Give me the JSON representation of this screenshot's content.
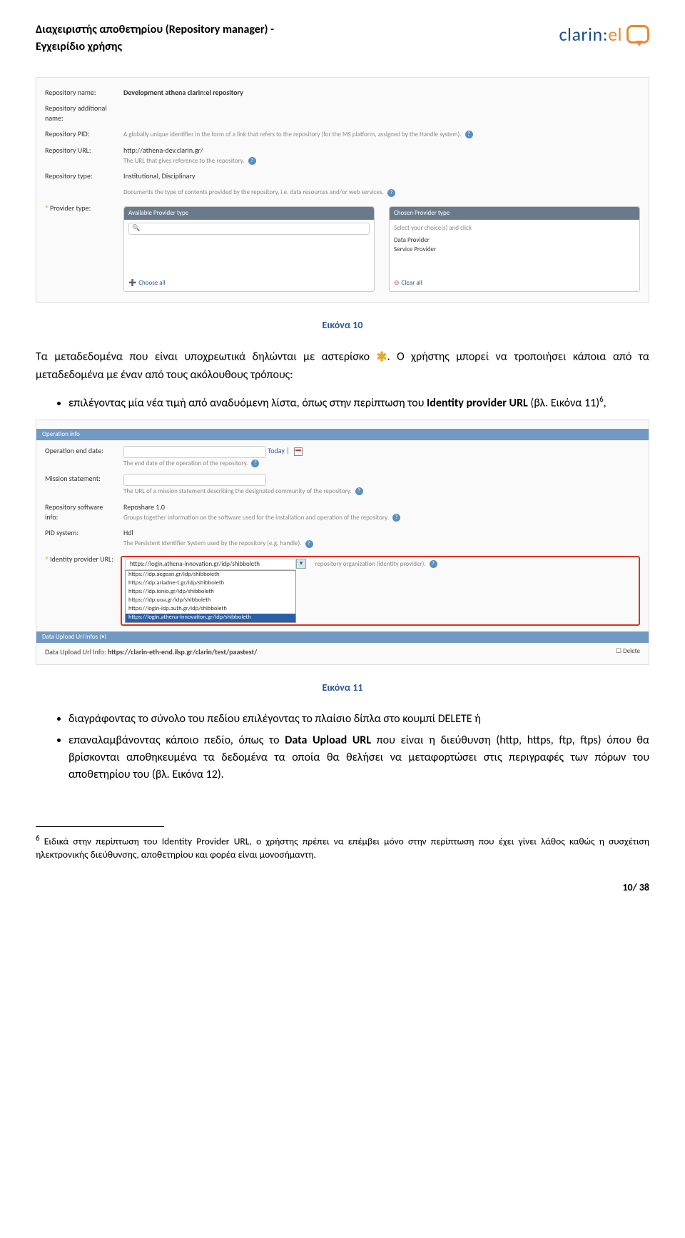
{
  "header": {
    "title_line1": "Διαχειριστής αποθετηρίου (Repository manager) -",
    "title_line2": "Εγχειρίδιο χρήσης",
    "logo_text": "clarin",
    "logo_suffix": "el"
  },
  "shot1": {
    "repo_name_label": "Repository name:",
    "repo_name_value": "Development athena clarin:el repository",
    "addl_name_label": "Repository additional name:",
    "pid_label": "Repository PID:",
    "pid_hint": "A globally unique identifier in the form of a link that refers to the repository (for the MS platform, assigned by the Handle system).",
    "url_label": "Repository URL:",
    "url_value": "http://athena-dev.clarin.gr/",
    "url_hint": "The URL that gives reference to the repository.",
    "type_label": "Repository type:",
    "type_value": "Institutional, Disciplinary",
    "type_hint": "Documents the type of contents provided by the repository, i.e. data resources and/or web services.",
    "provider_label": "Provider type:",
    "avail_head": "Available Provider type",
    "chosen_head": "Chosen Provider type",
    "search_icon_placeholder": "🔍",
    "chosen_hint": "Select your choice(s) and click",
    "chosen_items": [
      "Data Provider",
      "Service Provider"
    ],
    "choose_all": "Choose all",
    "clear_all": "Clear all"
  },
  "caption1": "Εικόνα 10",
  "para1_a": "Τα μεταδεδομένα που είναι υποχρεωτικά δηλώνται με αστερίσκο ",
  "para1_b": ". Ο χρήστης μπορεί να τροποιήσει κάποια από τα μεταδεδομένα με έναν από τους ακόλουθους τρόπους:",
  "bullet1_a": "επιλέγοντας μία νέα τιμή από αναδυόμενη λίστα, όπως στην περίπτωση του ",
  "bullet1_bold": "Identity provider URL",
  "bullet1_b": " (βλ. Εικόνα 11)",
  "bullet1_sup": "6",
  "bullet1_c": ",",
  "shot2": {
    "opinfo": "Operation info",
    "opend_label": "Operation end date:",
    "today": "Today |",
    "opend_hint": "The end date of the operation of the repository.",
    "mission_label": "Mission statement:",
    "mission_hint": "The URL of a mission statement describing the designated community of the repository.",
    "sw_label": "Repository software info:",
    "sw_value": "Reposhare 1.0",
    "sw_hint": "Groups together information on the software used for the installation and operation of the repository.",
    "pid_label": "PID system:",
    "pid_value": "Hdl",
    "pid_hint": "The Persistent Identifier System used by the repository (e.g. handle).",
    "idp_label": "Identity provider URL:",
    "idp_value": "https://login.athena-innovation.gr/idp/shibboleth",
    "idp_hint": "repository organization (identity provider).",
    "dd_items": [
      "https://idp.aegean.gr/idp/shibboleth",
      "https://idp.ariadne-t.gr/idp/shibboleth",
      "https://idp.ionio.gr/idp/shibboleth",
      "https://idp.uoa.gr/idp/shibboleth",
      "https://login-idp.auth.gr/idp/shibboleth",
      "https://login.athena-innovation.gr/idp/shibboleth"
    ],
    "upload_bar": "Data Upload Url Infos (•)",
    "upload_row_label": "Data Upload Url Info:",
    "upload_row_value": "https://clarin-eth-end.ilsp.gr/clarin/test/paastest/",
    "delete_label": "Delete"
  },
  "caption2": "Εικόνα 11",
  "bullet2": "διαγράφοντας το σύνολο του πεδίου επιλέγοντας το πλαίσιο δίπλα στο κουμπί DELETE ή",
  "bullet3_a": "επαναλαμβάνοντας κάποιο πεδίο, όπως το ",
  "bullet3_bold": "Data Upload URL",
  "bullet3_b": " που είναι η διεύθυνση (http, https, ftp, ftps) όπου θα βρίσκονται αποθηκευμένα τα δεδομένα τα οποία θα θελήσει να μεταφορτώσει στις περιγραφές των πόρων του αποθετηρίου του (βλ. Εικόνα 12).",
  "footnote_num": "6",
  "footnote_text": " Ειδικά στην περίπτωση του Identity Provider URL, ο χρήστης πρέπει να επέμβει μόνο στην περίπτωση που έχει γίνει λάθος καθώς η συσχέτιση ηλεκτρονικής διεύθυνσης, αποθετηρίου και φορέα είναι μονοσήμαντη.",
  "page_number": "10/ 38"
}
